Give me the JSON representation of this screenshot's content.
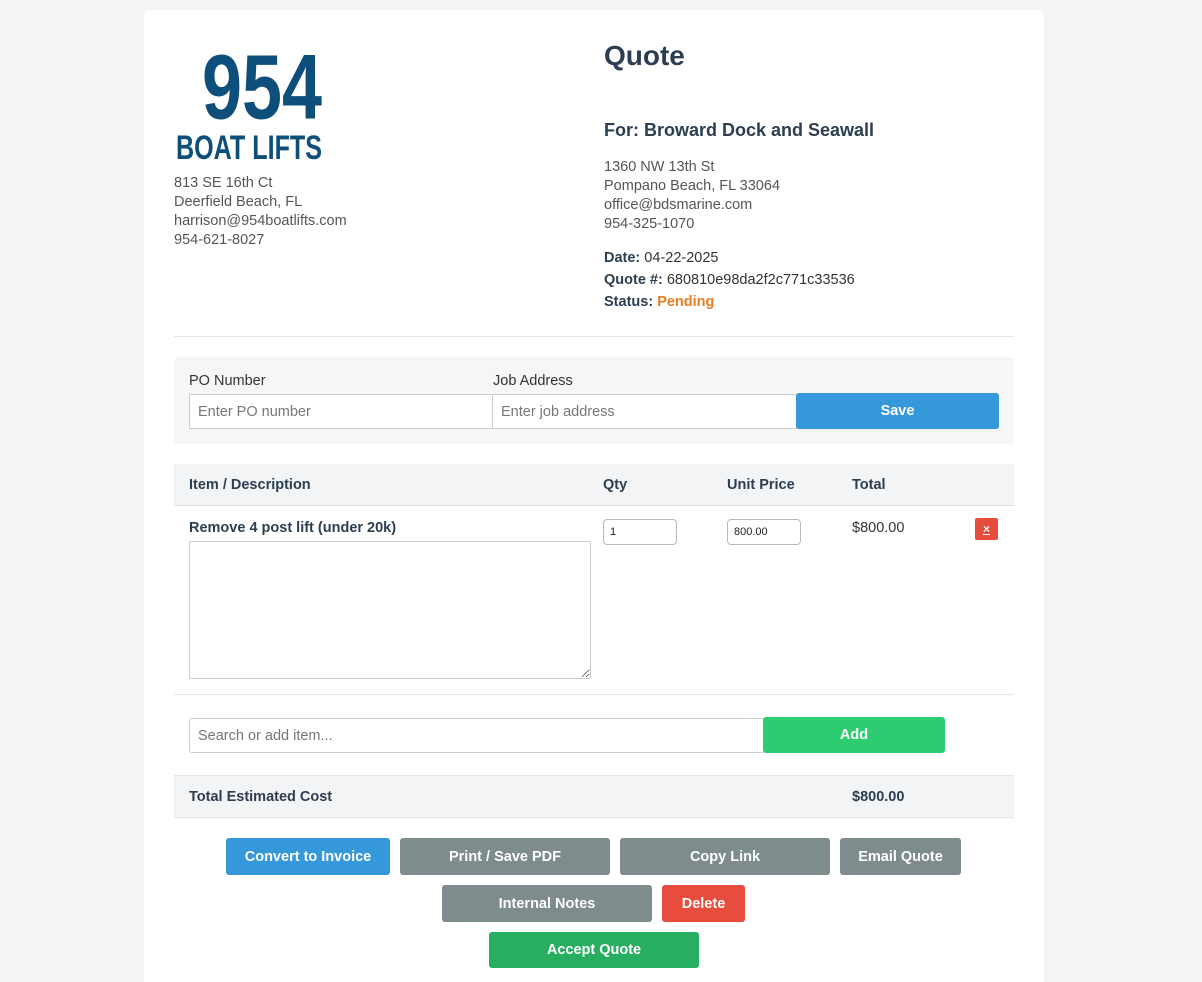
{
  "company": {
    "logo_line1": "954",
    "logo_line2": "BOAT LIFTS",
    "address1": "813 SE 16th Ct",
    "address2": "Deerfield Beach, FL",
    "email": "harrison@954boatlifts.com",
    "phone": "954-621-8027"
  },
  "quote": {
    "title": "Quote",
    "for_label": "For: Broward Dock and Seawall",
    "client_address1": "1360 NW 13th St",
    "client_address2": "Pompano Beach, FL 33064",
    "client_email": "office@bdsmarine.com",
    "client_phone": "954-325-1070",
    "date_label": "Date:",
    "date": "04-22-2025",
    "number_label": "Quote #:",
    "number": "680810e98da2f2c771c33536",
    "status_label": "Status:",
    "status": "Pending",
    "status_color": "#e67e22"
  },
  "po_form": {
    "po_label": "PO Number",
    "po_placeholder": "Enter PO number",
    "job_label": "Job Address",
    "job_placeholder": "Enter job address",
    "save_label": "Save"
  },
  "table": {
    "headers": [
      "Item / Description",
      "Qty",
      "Unit Price",
      "Total"
    ],
    "rows": [
      {
        "name": "Remove 4 post lift (under 20k)",
        "description": "",
        "qty": "1",
        "unit_price": "800.00",
        "total": "$800.00",
        "delete_glyph": "×"
      }
    ]
  },
  "add_item": {
    "placeholder": "Search or add item...",
    "add_label": "Add"
  },
  "summary": {
    "label": "Total Estimated Cost",
    "value": "$800.00"
  },
  "actions": {
    "convert": "Convert to Invoice",
    "print": "Print / Save PDF",
    "copy": "Copy Link",
    "email": "Email Quote",
    "notes": "Internal Notes",
    "delete": "Delete",
    "accept": "Accept Quote"
  },
  "colors": {
    "primary": "#3498db",
    "success": "#2ecc71",
    "accept": "#27ae60",
    "secondary": "#7f8c8d",
    "danger": "#e74c3c",
    "logo": "#0d4f7a"
  }
}
